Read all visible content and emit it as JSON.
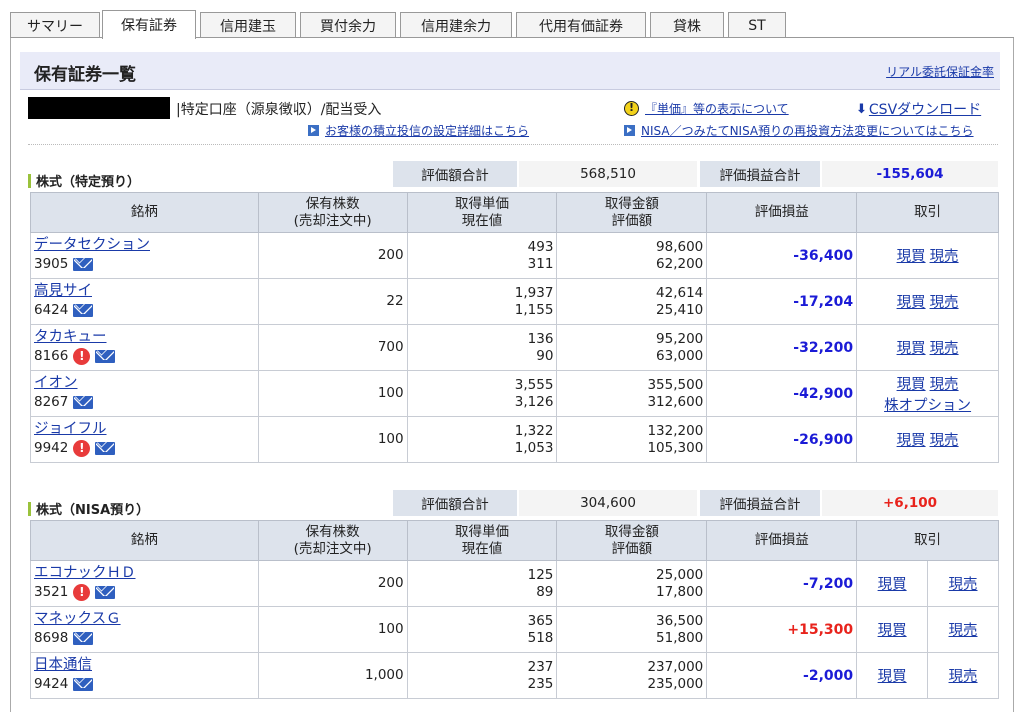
{
  "tabs": [
    "サマリー",
    "保有証券",
    "信用建玉",
    "買付余力",
    "信用建余力",
    "代用有価証券",
    "貸株",
    "ST"
  ],
  "page": {
    "title": "保有証券一覧",
    "top_right_link": "リアル委託保証金率",
    "account_text": "|特定口座（源泉徴収）/配当受入",
    "link_unit_price": "『単価』等の表示について",
    "link_csv": "CSVダウンロード",
    "link_tsumitate": "お客様の積立投信の設定詳細はこちら",
    "link_nisa": "NISA／つみたてNISA預りの再投資方法変更についてはこちら"
  },
  "headers": {
    "name": "銘柄",
    "qty1": "保有株数",
    "qty2": "(売却注文中)",
    "cost1": "取得単価",
    "cost2": "現在値",
    "amount1": "取得金額",
    "amount2": "評価額",
    "pl": "評価損益",
    "trade": "取引"
  },
  "summary_labels": {
    "total_value": "評価額合計",
    "total_pl": "評価損益合計"
  },
  "trade_labels": {
    "buy": "現買",
    "sell": "現売",
    "option": "株オプション"
  },
  "tokutei": {
    "title": "株式（特定預り）",
    "total_value": "568,510",
    "total_pl": "-155,604",
    "rows": [
      {
        "name": "データセクション",
        "code": "3905",
        "alert": false,
        "qty": "200",
        "cost": "493",
        "price": "311",
        "cost_amount": "98,600",
        "value": "62,200",
        "pl": "-36,400",
        "option": false
      },
      {
        "name": "高見サイ",
        "code": "6424",
        "alert": false,
        "qty": "22",
        "cost": "1,937",
        "price": "1,155",
        "cost_amount": "42,614",
        "value": "25,410",
        "pl": "-17,204",
        "option": false
      },
      {
        "name": "タカキュー",
        "code": "8166",
        "alert": true,
        "qty": "700",
        "cost": "136",
        "price": "90",
        "cost_amount": "95,200",
        "value": "63,000",
        "pl": "-32,200",
        "option": false
      },
      {
        "name": "イオン",
        "code": "8267",
        "alert": false,
        "qty": "100",
        "cost": "3,555",
        "price": "3,126",
        "cost_amount": "355,500",
        "value": "312,600",
        "pl": "-42,900",
        "option": true
      },
      {
        "name": "ジョイフル",
        "code": "9942",
        "alert": true,
        "qty": "100",
        "cost": "1,322",
        "price": "1,053",
        "cost_amount": "132,200",
        "value": "105,300",
        "pl": "-26,900",
        "option": false
      }
    ]
  },
  "nisa": {
    "title": "株式（NISA預り）",
    "total_value": "304,600",
    "total_pl": "+6,100",
    "rows": [
      {
        "name": "エコナックＨＤ",
        "code": "3521",
        "alert": true,
        "qty": "200",
        "cost": "125",
        "price": "89",
        "cost_amount": "25,000",
        "value": "17,800",
        "pl": "-7,200"
      },
      {
        "name": "マネックスＧ",
        "code": "8698",
        "alert": false,
        "qty": "100",
        "cost": "365",
        "price": "518",
        "cost_amount": "36,500",
        "value": "51,800",
        "pl": "+15,300"
      },
      {
        "name": "日本通信",
        "code": "9424",
        "alert": false,
        "qty": "1,000",
        "cost": "237",
        "price": "235",
        "cost_amount": "237,000",
        "value": "235,000",
        "pl": "-2,000"
      }
    ]
  }
}
